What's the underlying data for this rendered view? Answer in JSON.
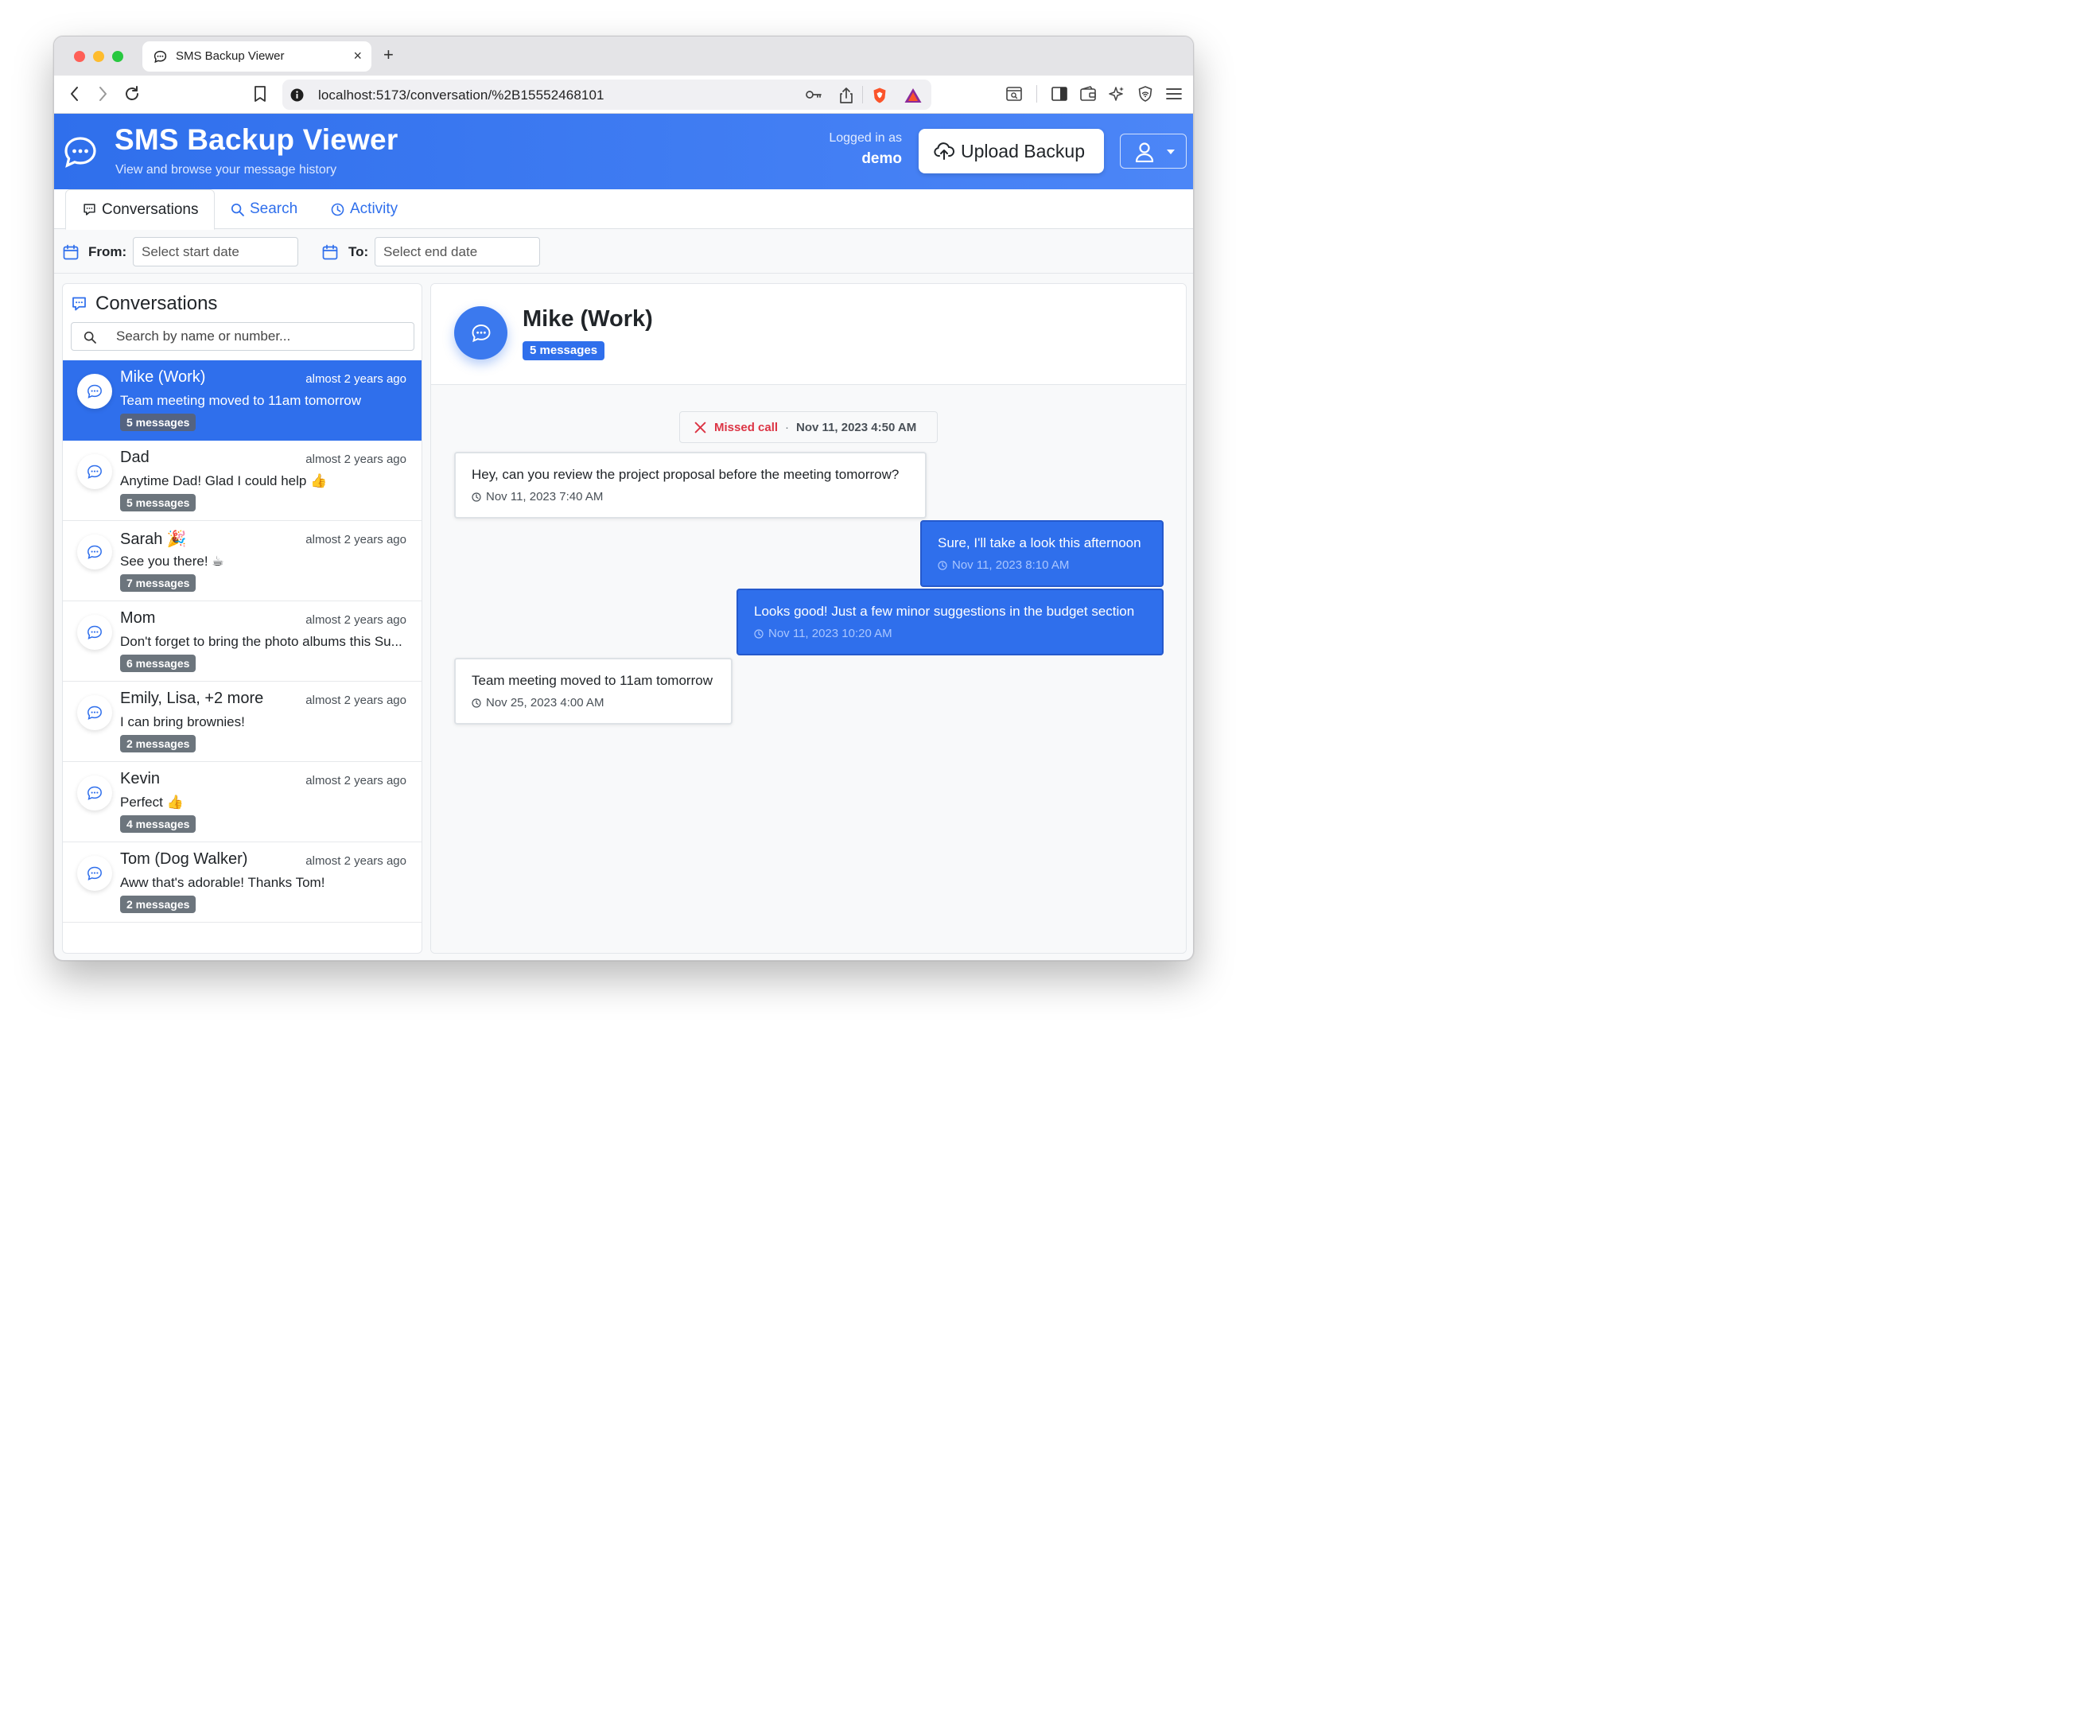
{
  "browser": {
    "tab_title": "SMS Backup Viewer",
    "new_tab_label": "+",
    "close_label": "×",
    "url": "localhost:5173/conversation/%2B15552468101"
  },
  "header": {
    "title": "SMS Backup Viewer",
    "subtitle": "View and browse your message history",
    "logged_in_label": "Logged in as",
    "username": "demo",
    "upload_label": "Upload Backup"
  },
  "nav": {
    "tabs": [
      {
        "label": "Conversations",
        "icon": "chat-square-icon",
        "active": true
      },
      {
        "label": "Search",
        "icon": "search-icon",
        "active": false
      },
      {
        "label": "Activity",
        "icon": "clock-icon",
        "active": false
      }
    ]
  },
  "filters": {
    "from_label": "From:",
    "from_placeholder": "Select start date",
    "to_label": "To:",
    "to_placeholder": "Select end date"
  },
  "sidebar": {
    "title": "Conversations",
    "search_placeholder": "Search by name or number...",
    "conversations": [
      {
        "name": "Mike (Work)",
        "time": "almost 2 years ago",
        "preview": "Team meeting moved to 11am tomorrow",
        "badge": "5 messages",
        "active": true
      },
      {
        "name": "Dad",
        "time": "almost 2 years ago",
        "preview": "Anytime Dad! Glad I could help 👍",
        "badge": "5 messages",
        "active": false
      },
      {
        "name": "Sarah 🎉",
        "time": "almost 2 years ago",
        "preview": "See you there! ☕",
        "badge": "7 messages",
        "active": false
      },
      {
        "name": "Mom",
        "time": "almost 2 years ago",
        "preview": "Don't forget to bring the photo albums this Su...",
        "badge": "6 messages",
        "active": false
      },
      {
        "name": "Emily, Lisa, +2 more",
        "time": "almost 2 years ago",
        "preview": "I can bring brownies!",
        "badge": "2 messages",
        "active": false
      },
      {
        "name": "Kevin",
        "time": "almost 2 years ago",
        "preview": "Perfect 👍",
        "badge": "4 messages",
        "active": false
      },
      {
        "name": "Tom (Dog Walker)",
        "time": "almost 2 years ago",
        "preview": "Aww that's adorable! Thanks Tom!",
        "badge": "2 messages",
        "active": false
      }
    ]
  },
  "conversation": {
    "contact_name": "Mike (Work)",
    "message_count": "5 messages",
    "missed_call": {
      "label": "Missed call",
      "separator": "·",
      "time": "Nov 11, 2023 4:50 AM"
    },
    "messages": [
      {
        "direction": "in",
        "text": "Hey, can you review the project proposal before the meeting tomorrow?",
        "time": "Nov 11, 2023 7:40 AM"
      },
      {
        "direction": "out",
        "text": "Sure, I'll take a look this afternoon",
        "time": "Nov 11, 2023 8:10 AM"
      },
      {
        "direction": "out",
        "text": "Looks good! Just a few minor suggestions in the budget section",
        "time": "Nov 11, 2023 10:20 AM"
      },
      {
        "direction": "in",
        "text": "Team meeting moved to 11am tomorrow",
        "time": "Nov 25, 2023 4:00 AM"
      }
    ]
  },
  "colors": {
    "primary": "#2f6fec",
    "danger": "#dc3545",
    "badge_gray": "#6c757d"
  }
}
